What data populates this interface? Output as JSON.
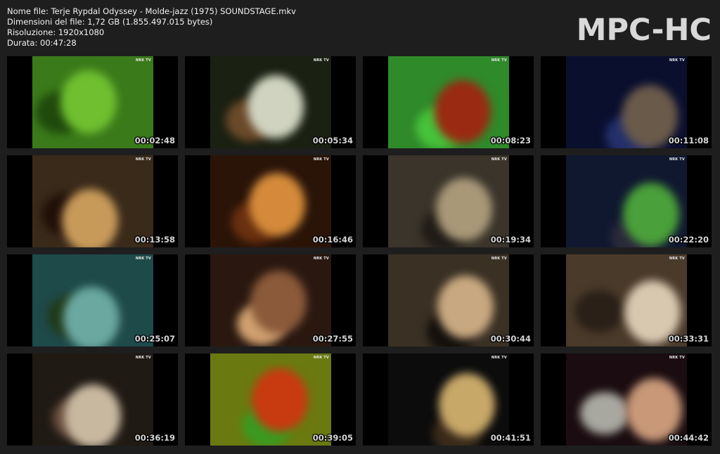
{
  "info": {
    "filename": "Nome file: Terje Rypdal Odyssey - Molde-jazz (1975) SOUNDSTAGE.mkv",
    "filesize": "Dimensioni del file: 1,72 GB (1.855.497.015 bytes)",
    "resolution": "Risoluzione: 1920x1080",
    "duration": "Durata: 00:47:28"
  },
  "logo": "MPC-HC",
  "channel_watermark": "NRK TV",
  "thumbnails": [
    {
      "time": "00:02:48",
      "bg": "#3a7a1a",
      "c1": "#6fbf30",
      "c2": "#1f4a0c"
    },
    {
      "time": "00:05:34",
      "bg": "#1a2012",
      "c1": "#cfd3c0",
      "c2": "#6b4a2a"
    },
    {
      "time": "00:08:23",
      "bg": "#2f8a2a",
      "c1": "#9a2a12",
      "c2": "#47c23a"
    },
    {
      "time": "00:11:08",
      "bg": "#0a0f2e",
      "c1": "#6a5a4a",
      "c2": "#23306a"
    },
    {
      "time": "00:13:58",
      "bg": "#3a2a1a",
      "c1": "#c89a5a",
      "c2": "#201008"
    },
    {
      "time": "00:16:46",
      "bg": "#2a1408",
      "c1": "#d48a3a",
      "c2": "#6a3010"
    },
    {
      "time": "00:19:34",
      "bg": "#3a342a",
      "c1": "#a89878",
      "c2": "#201c16"
    },
    {
      "time": "00:22:20",
      "bg": "#101830",
      "c1": "#4aa03a",
      "c2": "#2a2a3a"
    },
    {
      "time": "00:25:07",
      "bg": "#1e4a4a",
      "c1": "#6aa8a0",
      "c2": "#203a1a"
    },
    {
      "time": "00:27:55",
      "bg": "#2a1810",
      "c1": "#8a5a3a",
      "c2": "#d0a070"
    },
    {
      "time": "00:30:44",
      "bg": "#3a3024",
      "c1": "#c8a880",
      "c2": "#14100c"
    },
    {
      "time": "00:33:31",
      "bg": "#4a3a2a",
      "c1": "#d8c8b0",
      "c2": "#2a2018"
    },
    {
      "time": "00:36:19",
      "bg": "#201a14",
      "c1": "#c8b8a0",
      "c2": "#6a5040"
    },
    {
      "time": "00:39:05",
      "bg": "#6a7a10",
      "c1": "#c83a10",
      "c2": "#3a9a20"
    },
    {
      "time": "00:41:51",
      "bg": "#0c0c0c",
      "c1": "#c8a868",
      "c2": "#3a2a1a"
    },
    {
      "time": "00:44:42",
      "bg": "#1a0c10",
      "c1": "#c89878",
      "c2": "#a8a8a0"
    }
  ]
}
